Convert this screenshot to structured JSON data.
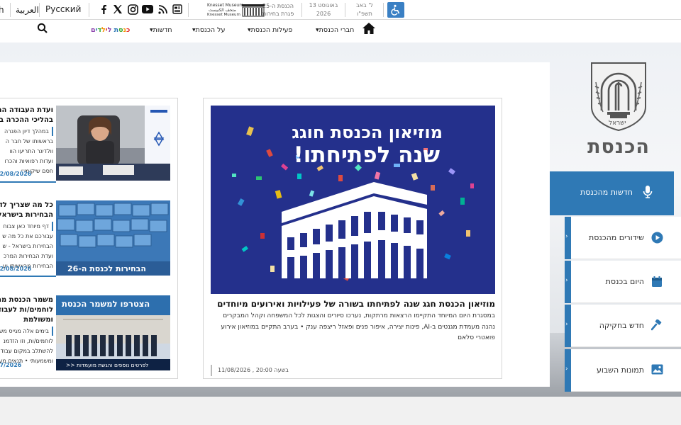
{
  "topbar": {
    "lang_cut": "h",
    "lang_arabic": "العربية",
    "lang_russian": "Русский",
    "social": [
      "facebook-icon",
      "x-icon",
      "instagram-icon",
      "youtube-icon",
      "rss-icon",
      "newsletter-icon"
    ],
    "museum": {
      "line_en": "Knesset Museum",
      "line_ar": "متحف الكنيست",
      "line_en2": "Knesset Museum",
      "line_he1": "הכנסת ה-25",
      "line_he2": "פגרת בחירות"
    },
    "greg_date_1": "13 באוגוסט",
    "greg_date_2": "2026",
    "heb_date_1": "ל' באב",
    "heb_date_2": "תשפ\"ו",
    "accessibility_icon": "wheelchair-icon",
    "colors": {
      "accessibility_bg": "#3a80c4",
      "border": "#d9d9d9"
    }
  },
  "nav": {
    "home_icon": "home-icon",
    "items": [
      {
        "label": "חברי הכנסת",
        "has_caret": true
      },
      {
        "label": "פעילות הכנסת",
        "has_caret": true
      },
      {
        "label": "על הכנסת",
        "has_caret": true
      },
      {
        "label": "חדשות",
        "has_caret": true
      }
    ],
    "kids_label": "כנסת לילדים",
    "search_icon": "search-icon"
  },
  "brand": {
    "name": "הכנסת",
    "emblem": "menorah-emblem",
    "emblem_text": "ישראל"
  },
  "side_menu": {
    "active": {
      "label": "חדשות מהכנסת",
      "icon": "microphone-icon"
    },
    "items": [
      {
        "label": "שידורים מהכנסת",
        "icon": "play-icon"
      },
      {
        "label": "היום בכנסת",
        "icon": "calendar-icon"
      },
      {
        "label": "חדש בחקיקה",
        "icon": "gavel-icon"
      },
      {
        "label": "תמונות השבוע",
        "icon": "image-icon"
      }
    ],
    "expand_glyph": "›",
    "colors": {
      "accent": "#2f79b5"
    }
  },
  "feature": {
    "image_line1": "מוזיאון הכנסת חוגג",
    "image_line2": "שנה לפתיחתו!",
    "title": "מוזיאון הכנסת חגג שנה לפתיחתו בשורה של פעילויות ואירועים מיוחדים",
    "body": "במסגרת היום המיוחד התקיימו הרצאות מרתקות, נערכו סיורים והצגות לכל המשפחה וקהל המבקרים נהנה מעמדת מגנטים ב-AI, פינות יצירה, איפור פנים ופאזל ריצפה ענק • בערב התקיים במוזיאון אירוע פואטרי סלאם",
    "date": "11/08/2026 , בשעה 20:00",
    "colors": {
      "image_bg": "#24308c"
    }
  },
  "news": [
    {
      "title_1": "ועדת העבודה הר",
      "title_2": "בהליכי ההכרה בפ",
      "sub": "במהלך דיון הפגרה",
      "body": [
        "בראשותו של חבר ה",
        "וולדיגר התריעו הוו",
        "ועדות רפואיות והכרו",
        "חסם שיקומי״"
      ],
      "date": "12/08/2026"
    },
    {
      "title_1": "כל מה שצריך לדע",
      "title_2": "הבחירות בישראל",
      "sub": "דף מיוחד כאן צבוח",
      "body": [
        "עבורכם את כל מה ש",
        "הבחירות בישראל - ש",
        "ועדת הבחירות המרכ",
        "הבחירות מראשיתו וע"
      ],
      "date": "12/08/2026",
      "thumb_caption": "הבחירות לכנסת ה-26"
    },
    {
      "title_1": "משמר הכנסת מח",
      "title_2": "לוחמים/ות לעבוד",
      "title_3": "ומשולמת",
      "sub": "בימים אלה מגייס מש",
      "body": [
        "לוחמים/ות, וזו הזדמנ",
        "להשתלב במקום עבוד",
        "ומשמעותי • תנאים מע"
      ],
      "date": "07/2026",
      "thumb_caption": "הצטרפו למשמר הכנסת",
      "thumb_footer": "לפרטים נוספים והגשת מועמדות <<"
    }
  ]
}
